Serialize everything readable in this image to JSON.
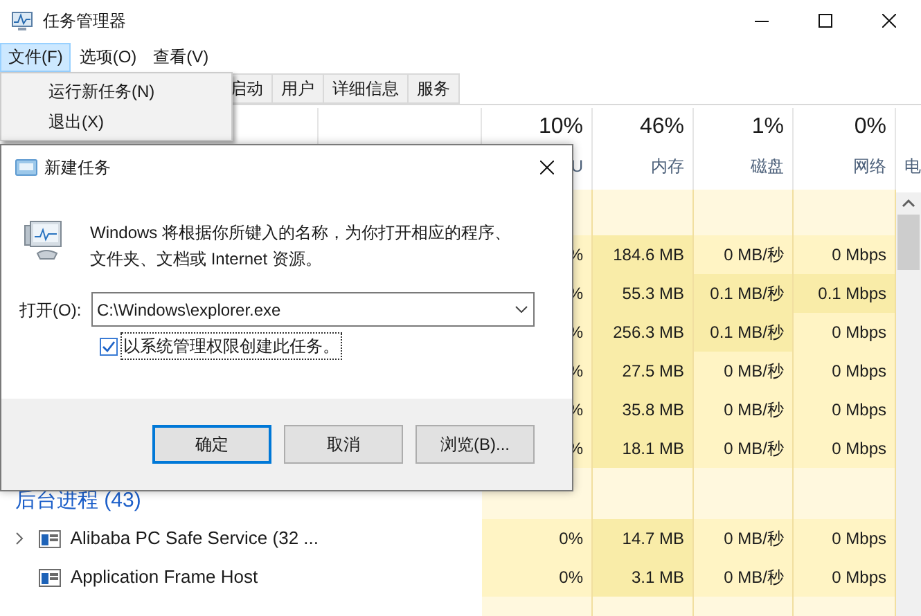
{
  "window": {
    "title": "任务管理器"
  },
  "menu_bar": [
    {
      "label": "文件(F)",
      "selected": true
    },
    {
      "label": "选项(O)",
      "selected": false
    },
    {
      "label": "查看(V)",
      "selected": false
    }
  ],
  "file_menu": {
    "items": [
      "运行新任务(N)",
      "退出(X)"
    ]
  },
  "tabs": [
    {
      "label": "启动",
      "selected": false
    },
    {
      "label": "用户",
      "selected": false
    },
    {
      "label": "详细信息",
      "selected": false
    },
    {
      "label": "服务",
      "selected": false
    }
  ],
  "table": {
    "columns": [
      {
        "percent": "10%",
        "label": "U"
      },
      {
        "percent": "46%",
        "label": "内存"
      },
      {
        "percent": "1%",
        "label": "磁盘"
      },
      {
        "percent": "0%",
        "label": "网络"
      },
      {
        "label": "电"
      }
    ],
    "app_rows": [
      {
        "cells": [
          {
            "text": "%",
            "hot": false
          },
          {
            "text": "184.6 MB",
            "hot": true
          },
          {
            "text": "0 MB/秒",
            "hot": false
          },
          {
            "text": "0 Mbps",
            "hot": false
          }
        ]
      },
      {
        "cells": [
          {
            "text": "%",
            "hot": false
          },
          {
            "text": "55.3 MB",
            "hot": true
          },
          {
            "text": "0.1 MB/秒",
            "hot": true
          },
          {
            "text": "0.1 Mbps",
            "hot": true
          }
        ]
      },
      {
        "cells": [
          {
            "text": "%",
            "hot": false
          },
          {
            "text": "256.3 MB",
            "hot": true
          },
          {
            "text": "0.1 MB/秒",
            "hot": true
          },
          {
            "text": "0 Mbps",
            "hot": false
          }
        ]
      },
      {
        "cells": [
          {
            "text": "%",
            "hot": false
          },
          {
            "text": "27.5 MB",
            "hot": true
          },
          {
            "text": "0 MB/秒",
            "hot": false
          },
          {
            "text": "0 Mbps",
            "hot": false
          }
        ]
      },
      {
        "cells": [
          {
            "text": "%",
            "hot": false
          },
          {
            "text": "35.8 MB",
            "hot": true
          },
          {
            "text": "0 MB/秒",
            "hot": false
          },
          {
            "text": "0 Mbps",
            "hot": false
          }
        ]
      },
      {
        "cells": [
          {
            "text": "%",
            "hot": false
          },
          {
            "text": "18.1 MB",
            "hot": true
          },
          {
            "text": "0 MB/秒",
            "hot": false
          },
          {
            "text": "0 Mbps",
            "hot": false
          }
        ]
      }
    ],
    "background_group": {
      "title": "后台进程 (43)",
      "rows": [
        {
          "name": "Alibaba PC Safe Service (32 ...",
          "expandable": true,
          "cells": [
            {
              "text": "0%",
              "hot": false
            },
            {
              "text": "14.7 MB",
              "hot": true
            },
            {
              "text": "0 MB/秒",
              "hot": false
            },
            {
              "text": "0 Mbps",
              "hot": false
            }
          ]
        },
        {
          "name": "Application Frame Host",
          "expandable": false,
          "cells": [
            {
              "text": "0%",
              "hot": false
            },
            {
              "text": "3.1 MB",
              "hot": true
            },
            {
              "text": "0 MB/秒",
              "hot": false
            },
            {
              "text": "0 Mbps",
              "hot": false
            }
          ]
        }
      ]
    }
  },
  "dialog": {
    "title": "新建任务",
    "message_lines": [
      "Windows 将根据你所键入的名称，为你打开相应的程序、",
      "文件夹、文档或 Internet 资源。"
    ],
    "open_label": "打开(O):",
    "open_value": "C:\\Windows\\explorer.exe",
    "admin_checkbox": {
      "label": "以系统管理权限创建此任务。",
      "checked": true
    },
    "buttons": [
      {
        "label": "确定",
        "default": true
      },
      {
        "label": "取消",
        "default": false
      },
      {
        "label": "浏览(B)...",
        "default": false
      }
    ]
  }
}
